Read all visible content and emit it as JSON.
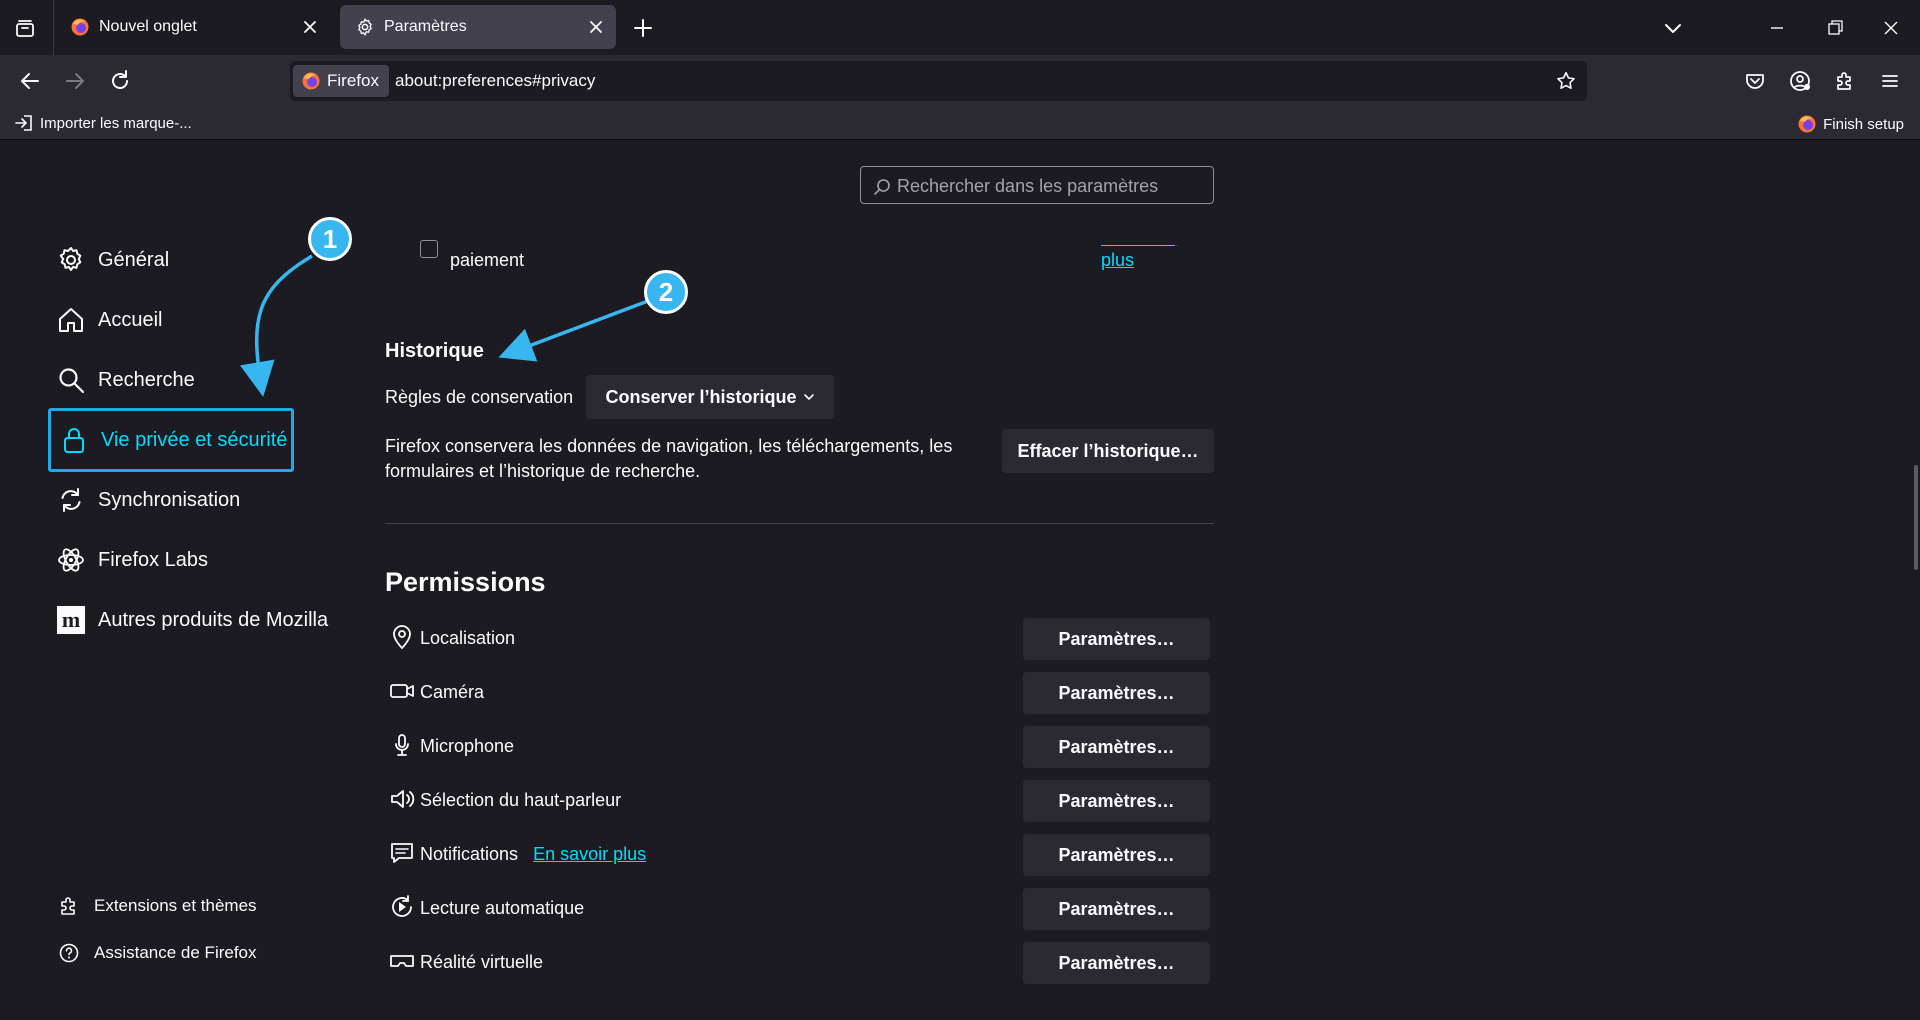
{
  "tabs": [
    {
      "label": "Nouvel onglet",
      "icon": "firefox-logo-icon",
      "active": false
    },
    {
      "label": "Paramètres",
      "icon": "gear-icon",
      "active": true
    }
  ],
  "urlbar": {
    "identity_label": "Firefox",
    "url": "about:preferences#privacy"
  },
  "bookmarks": {
    "import_label": "Importer les marque-...",
    "finish_setup_label": "Finish setup"
  },
  "search": {
    "placeholder": "Rechercher dans les paramètres"
  },
  "sidebar": {
    "categories": [
      {
        "label": "Général",
        "icon": "gear-icon"
      },
      {
        "label": "Accueil",
        "icon": "home-icon"
      },
      {
        "label": "Recherche",
        "icon": "search-icon"
      },
      {
        "label": "Vie privée et sécurité",
        "icon": "lock-icon",
        "selected": true
      },
      {
        "label": "Synchronisation",
        "icon": "sync-icon"
      },
      {
        "label": "Firefox Labs",
        "icon": "atom-icon"
      },
      {
        "label": "Autres produits de Mozilla",
        "icon": "mozilla-m-icon"
      }
    ],
    "footer": [
      {
        "label": "Extensions et thèmes",
        "icon": "puzzle-icon"
      },
      {
        "label": "Assistance de Firefox",
        "icon": "help-icon"
      }
    ]
  },
  "partial_row": {
    "text": "paiement",
    "link": "plus"
  },
  "history": {
    "heading": "Historique",
    "retention_label": "Règles de conservation",
    "retention_value": "Conserver l’historique",
    "description": "Firefox conservera les données de navigation, les téléchargements, les formulaires et l’historique de recherche.",
    "clear_button": "Effacer l’historique…"
  },
  "permissions": {
    "heading": "Permissions",
    "button_label": "Paramètres…",
    "items": [
      {
        "label": "Localisation",
        "icon": "location-pin-icon"
      },
      {
        "label": "Caméra",
        "icon": "camera-icon"
      },
      {
        "label": "Microphone",
        "icon": "microphone-icon"
      },
      {
        "label": "Sélection du haut-parleur",
        "icon": "speaker-icon"
      },
      {
        "label": "Notifications",
        "icon": "notification-icon",
        "link": "En savoir plus"
      },
      {
        "label": "Lecture automatique",
        "icon": "autoplay-icon"
      },
      {
        "label": "Réalité virtuelle",
        "icon": "vr-headset-icon"
      }
    ]
  },
  "annotations": [
    {
      "number": "1"
    },
    {
      "number": "2"
    }
  ],
  "colors": {
    "accent": "#00ddff",
    "badge": "#38b6f0",
    "background": "#1c1b22",
    "button": "#2b2a33"
  }
}
